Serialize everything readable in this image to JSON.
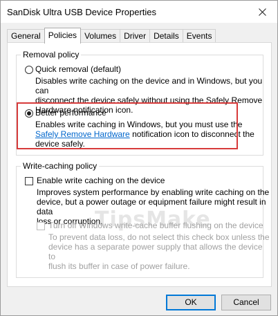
{
  "window": {
    "title": "SanDisk Ultra USB Device Properties"
  },
  "tabs": [
    {
      "label": "General"
    },
    {
      "label": "Policies"
    },
    {
      "label": "Volumes"
    },
    {
      "label": "Driver"
    },
    {
      "label": "Details"
    },
    {
      "label": "Events"
    }
  ],
  "active_tab": "Policies",
  "removal_policy": {
    "label": "Removal policy",
    "selected": "Better performance",
    "quick": {
      "label": "Quick removal (default)",
      "description": [
        "Disables write caching on the device and in Windows, but you can",
        "disconnect the device safely without using the Safely Remove",
        "Hardware notification icon."
      ]
    },
    "better": {
      "label": "Better performance",
      "desc_line1": "Enables write caching in Windows, but you must use the",
      "link": "Safely Remove Hardware",
      "desc_line2_rest": " notification icon to disconnect the",
      "desc_line3": "device safely."
    }
  },
  "write_caching_policy": {
    "label": "Write-caching policy",
    "enable": {
      "label": "Enable write caching on the device",
      "checked": false,
      "description": [
        "Improves system performance by enabling write caching on the",
        "device, but a power outage or equipment failure might result in data",
        "loss or corruption."
      ]
    },
    "turn_off": {
      "label": "Turn off Windows write-cache buffer flushing on the device",
      "checked": false,
      "enabled": false,
      "description": [
        "To prevent data loss, do not select this check box unless the",
        "device has a separate power supply that allows the device to",
        "flush its buffer in case of power failure."
      ]
    }
  },
  "watermark": "TipsMake",
  "buttons": {
    "ok": "OK",
    "cancel": "Cancel"
  },
  "colors": {
    "highlight": "#d73a3a",
    "link": "#0066cc",
    "default_button_border": "#0078d7"
  }
}
